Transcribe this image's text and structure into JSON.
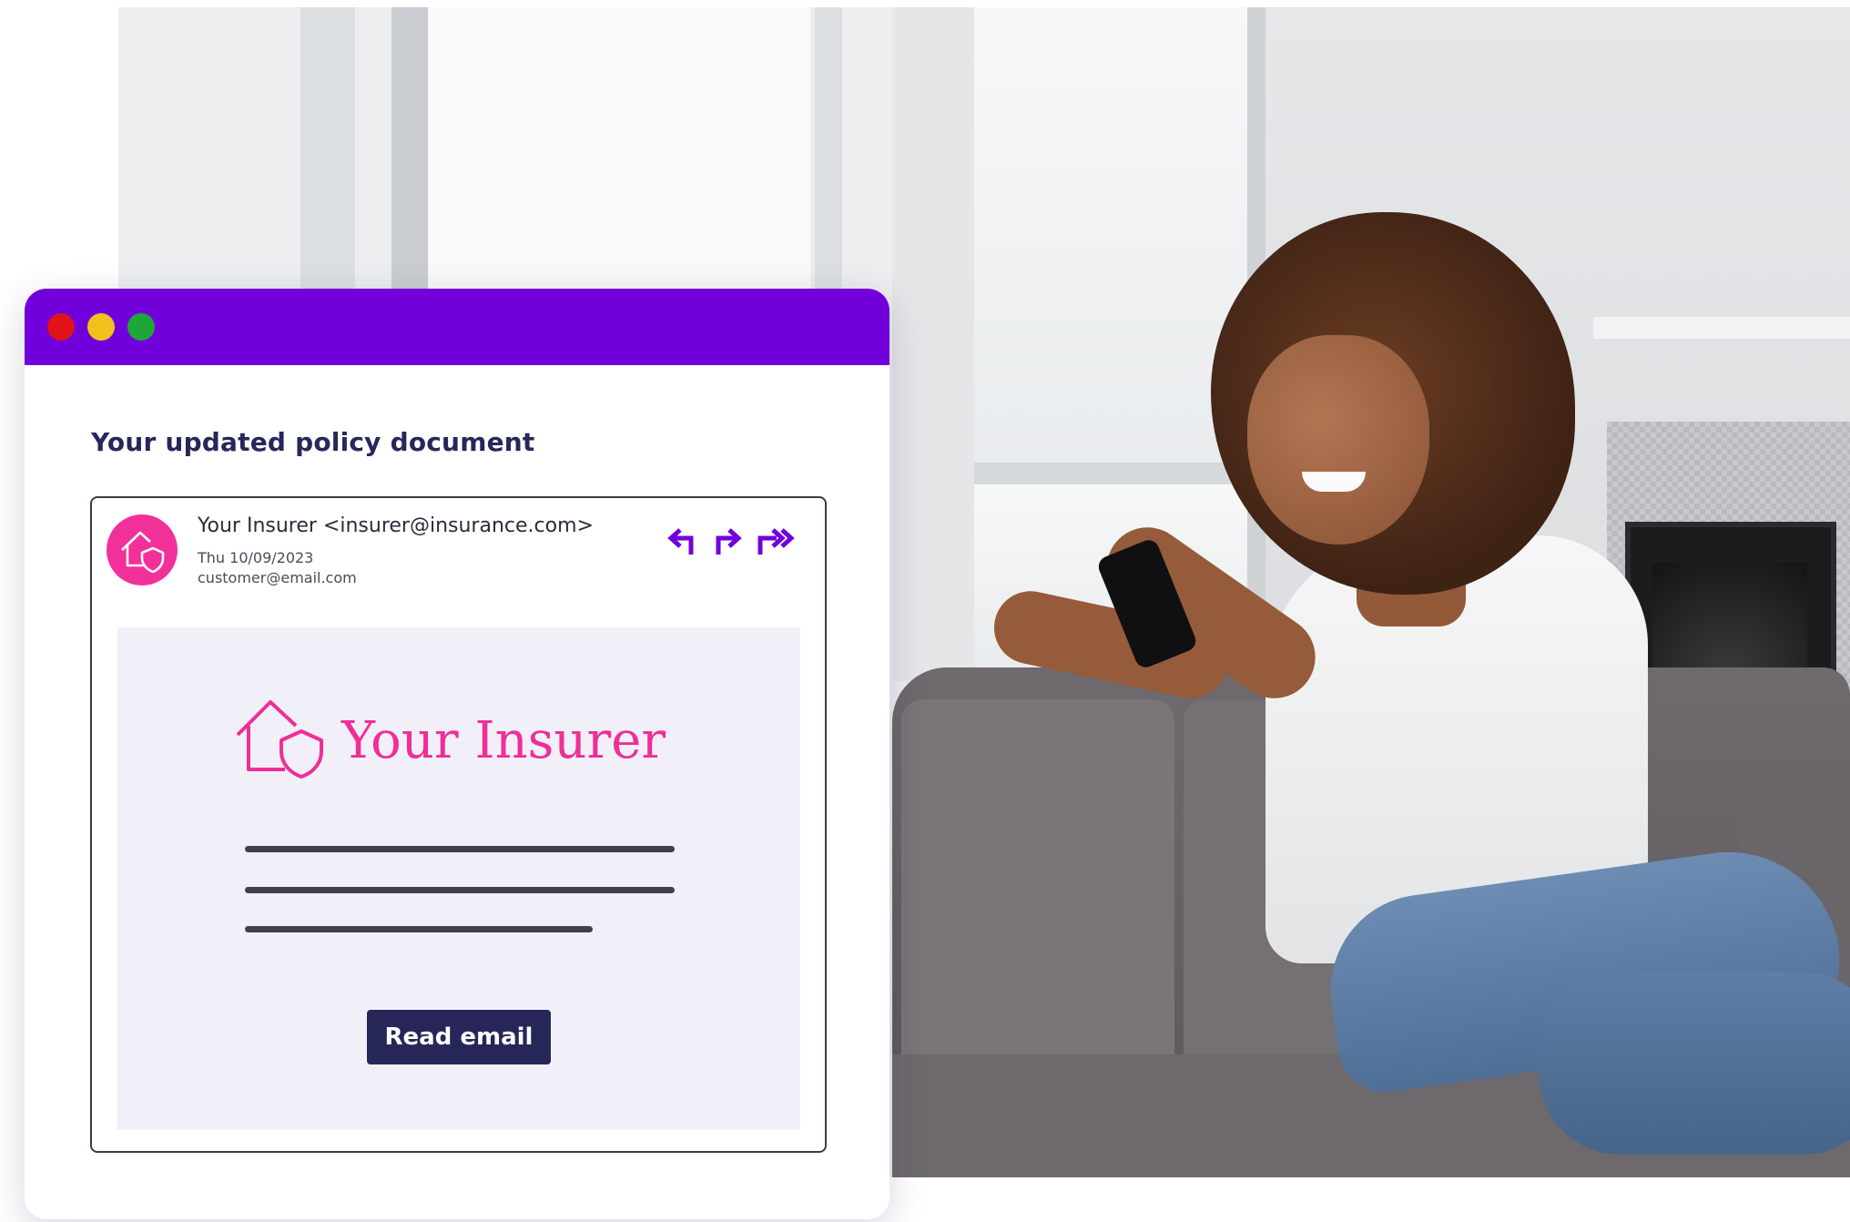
{
  "window": {
    "controls": [
      "close",
      "minimize",
      "maximize"
    ],
    "subject": "Your updated policy document"
  },
  "email": {
    "sender": "Your Insurer <insurer@insurance.com>",
    "date": "Thu 10/09/2023",
    "recipient": "customer@email.com",
    "avatar_icon": "house-shield-icon",
    "actions": [
      "reply-icon",
      "reply-all-icon",
      "forward-icon"
    ]
  },
  "body": {
    "logo_text": "Your Insurer",
    "read_button": "Read email"
  },
  "colors": {
    "titlebar": "#7200db",
    "brand_pink": "#ef2f96",
    "button": "#262758",
    "body_bg": "#f1f0f8"
  }
}
